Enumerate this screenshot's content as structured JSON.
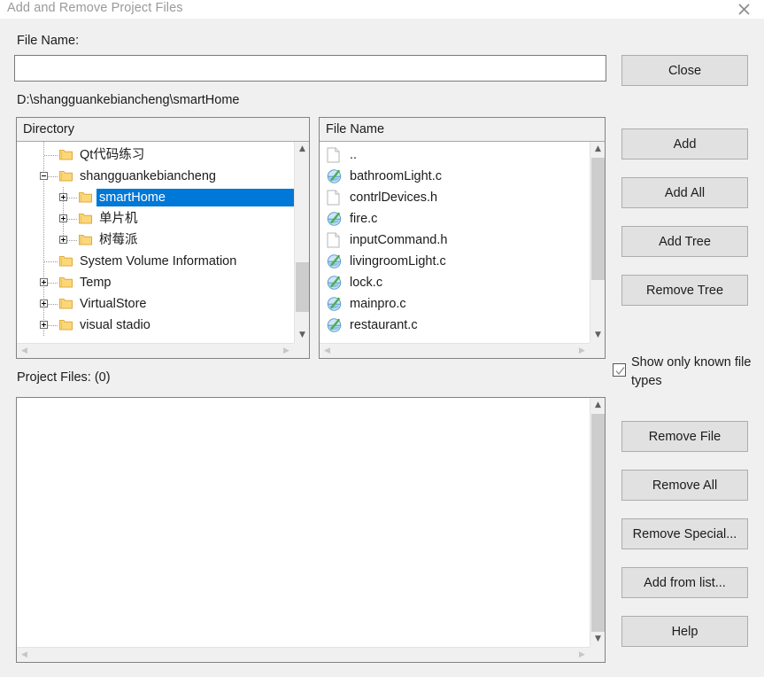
{
  "window": {
    "title": "Add and Remove Project Files",
    "close_icon": "close-icon"
  },
  "form": {
    "file_name_label": "File Name:",
    "file_name_value": "",
    "file_name_placeholder": "",
    "current_path": "D:\\shangguankebiancheng\\smartHome"
  },
  "directory_panel": {
    "header": "Directory",
    "items": [
      {
        "label": "Qt代码练习",
        "depth": 1,
        "toggle": "none",
        "selected": false
      },
      {
        "label": "shangguankebiancheng",
        "depth": 1,
        "toggle": "minus",
        "selected": false
      },
      {
        "label": "smartHome",
        "depth": 2,
        "toggle": "plus",
        "selected": true
      },
      {
        "label": "单片机",
        "depth": 2,
        "toggle": "plus",
        "selected": false
      },
      {
        "label": "树莓派",
        "depth": 2,
        "toggle": "plus",
        "selected": false
      },
      {
        "label": "System Volume Information",
        "depth": 1,
        "toggle": "none",
        "selected": false
      },
      {
        "label": "Temp",
        "depth": 1,
        "toggle": "plus",
        "selected": false
      },
      {
        "label": "VirtualStore",
        "depth": 1,
        "toggle": "plus",
        "selected": false
      },
      {
        "label": "visual stadio",
        "depth": 1,
        "toggle": "plus",
        "selected": false
      }
    ]
  },
  "file_panel": {
    "header": "File Name",
    "items": [
      {
        "label": "..",
        "icon": "document-icon"
      },
      {
        "label": "bathroomLight.c",
        "icon": "c-source-icon"
      },
      {
        "label": "contrlDevices.h",
        "icon": "document-icon"
      },
      {
        "label": "fire.c",
        "icon": "c-source-icon"
      },
      {
        "label": "inputCommand.h",
        "icon": "document-icon"
      },
      {
        "label": "livingroomLight.c",
        "icon": "c-source-icon"
      },
      {
        "label": "lock.c",
        "icon": "c-source-icon"
      },
      {
        "label": "mainpro.c",
        "icon": "c-source-icon"
      },
      {
        "label": "restaurant.c",
        "icon": "c-source-icon"
      }
    ]
  },
  "project_files_panel": {
    "label": "Project Files: (0)",
    "count": 0,
    "items": []
  },
  "buttons": {
    "close": "Close",
    "add": "Add",
    "add_all": "Add All",
    "add_tree": "Add Tree",
    "remove_tree": "Remove Tree",
    "remove_file": "Remove File",
    "remove_all": "Remove All",
    "remove_special": "Remove Special...",
    "add_from_list": "Add from list...",
    "help": "Help"
  },
  "checkbox": {
    "label": "Show only known file types",
    "checked": true
  },
  "colors": {
    "selection_blue": "#0078d7",
    "dialog_background": "#f0f0f0",
    "button_face": "#e1e1e1",
    "scrollbar_thumb": "#cdcdcd",
    "folder_yellow": "#ffd34e"
  }
}
